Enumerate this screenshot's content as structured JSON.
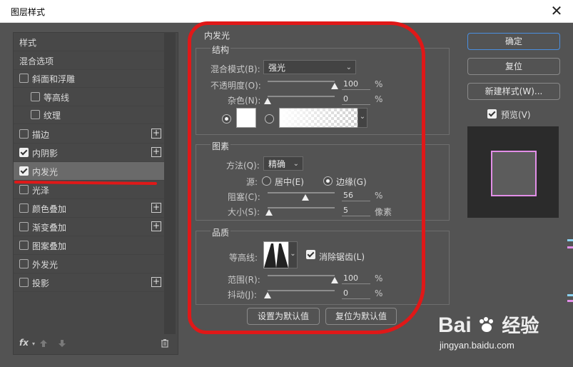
{
  "dialog": {
    "title": "图层样式",
    "close_glyph": "✕"
  },
  "left": {
    "items": [
      {
        "label": "样式"
      },
      {
        "label": "混合选项"
      },
      {
        "label": "斜面和浮雕",
        "checked": false
      },
      {
        "label": "等高线",
        "checked": false
      },
      {
        "label": "纹理",
        "checked": false
      },
      {
        "label": "描边",
        "checked": false,
        "plus": "+"
      },
      {
        "label": "内阴影",
        "checked": true,
        "plus": "+"
      },
      {
        "label": "内发光",
        "checked": true
      },
      {
        "label": "光泽",
        "checked": false
      },
      {
        "label": "颜色叠加",
        "checked": false,
        "plus": "+"
      },
      {
        "label": "渐变叠加",
        "checked": false,
        "plus": "+"
      },
      {
        "label": "图案叠加",
        "checked": false
      },
      {
        "label": "外发光",
        "checked": false
      },
      {
        "label": "投影",
        "checked": false,
        "plus": "+"
      }
    ],
    "fx_label": "fx",
    "icons": [
      "fx-icon",
      "arrow-up-icon",
      "arrow-down-icon",
      "trash-icon"
    ]
  },
  "panel": {
    "section_title": "内发光",
    "structure": {
      "title": "结构",
      "blend_mode_label": "混合模式(B):",
      "blend_mode_value": "强光",
      "opacity_label": "不透明度(O):",
      "opacity_value": "100",
      "opacity_pct": 100,
      "noise_label": "杂色(N):",
      "noise_value": "0",
      "noise_pct": 0,
      "percent": "%"
    },
    "elements": {
      "title": "图素",
      "method_label": "方法(Q):",
      "method_value": "精确",
      "source_label": "源:",
      "center_label": "居中(E)",
      "edge_label": "边缘(G)",
      "choke_label": "阻塞(C):",
      "choke_value": "56",
      "choke_pct": 56,
      "size_label": "大小(S):",
      "size_value": "5",
      "size_pct": 2,
      "size_unit": "像素",
      "percent": "%"
    },
    "quality": {
      "title": "品质",
      "contour_label": "等高线:",
      "antialias_label": "消除锯齿(L)",
      "antialias_checked": true,
      "range_label": "范围(R):",
      "range_value": "100",
      "range_pct": 100,
      "jitter_label": "抖动(J):",
      "jitter_value": "0",
      "jitter_pct": 0,
      "percent": "%"
    },
    "set_default": "设置为默认值",
    "reset_default": "复位为默认值"
  },
  "right": {
    "ok": "确定",
    "reset": "复位",
    "new_style": "新建样式(W)...",
    "preview_label": "预览(V)",
    "preview_checked": true,
    "preview_border_color": "#e28ee8"
  },
  "colors": {
    "annotation": "#e01818",
    "accent": "#4a8fe0"
  },
  "watermark": {
    "brand": "Bai",
    "suffix": "经验",
    "url": "jingyan.baidu.com"
  }
}
